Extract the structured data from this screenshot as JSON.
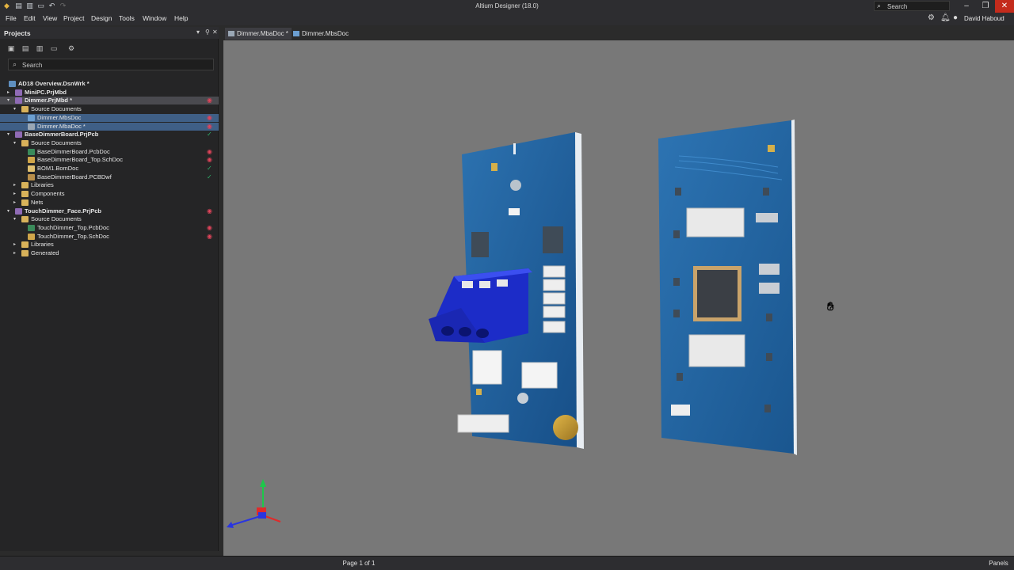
{
  "window": {
    "title": "Altium Designer (18.0)",
    "search_placeholder": "Search",
    "user": "David Haboud"
  },
  "menu": [
    "File",
    "Edit",
    "View",
    "Project",
    "Design",
    "Tools",
    "Window",
    "Help"
  ],
  "projects_panel": {
    "title": "Projects",
    "search_placeholder": "Search",
    "tree": [
      {
        "label": "AD18 Overview.DsnWrk *",
        "icon": "workspace-icon",
        "level": 0,
        "bold": true,
        "status": ""
      },
      {
        "label": "MiniPC.PrjMbd",
        "icon": "project-icon",
        "level": 1,
        "bold": true,
        "status": "",
        "arrow": "▸"
      },
      {
        "label": "Dimmer.PrjMbd *",
        "icon": "project-icon",
        "level": 1,
        "bold": true,
        "status": "modified",
        "arrow": "▾",
        "selected": true
      },
      {
        "label": "Source Documents",
        "icon": "folder-icon",
        "level": 2,
        "status": "",
        "arrow": "▾"
      },
      {
        "label": "Dimmer.MbsDoc",
        "icon": "mbs-doc-icon",
        "level": 3,
        "status": "modified",
        "current": true
      },
      {
        "label": "Dimmer.MbaDoc *",
        "icon": "mba-doc-icon",
        "level": 3,
        "status": "modified",
        "current": true
      },
      {
        "label": "BaseDimmerBoard.PrjPcb",
        "icon": "project-icon",
        "level": 1,
        "bold": true,
        "status": "ok",
        "arrow": "▾"
      },
      {
        "label": "Source Documents",
        "icon": "folder-icon",
        "level": 2,
        "status": "",
        "arrow": "▾"
      },
      {
        "label": "BaseDimmerBoard.PcbDoc",
        "icon": "pcb-doc-icon",
        "level": 3,
        "status": "modified"
      },
      {
        "label": "BaseDimmerBoard_Top.SchDoc",
        "icon": "sch-doc-icon",
        "level": 3,
        "status": "modified"
      },
      {
        "label": "BOM1.BomDoc",
        "icon": "bom-doc-icon",
        "level": 3,
        "status": "ok"
      },
      {
        "label": "BaseDimmerBoard.PCBDwf",
        "icon": "dwf-doc-icon",
        "level": 3,
        "status": "ok"
      },
      {
        "label": "Libraries",
        "icon": "folder-icon",
        "level": 2,
        "status": "",
        "arrow": "▸"
      },
      {
        "label": "Components",
        "icon": "folder-icon",
        "level": 2,
        "status": "",
        "arrow": "▸"
      },
      {
        "label": "Nets",
        "icon": "folder-icon",
        "level": 2,
        "status": "",
        "arrow": "▸"
      },
      {
        "label": "TouchDimmer_Face.PrjPcb",
        "icon": "project-icon",
        "level": 1,
        "bold": true,
        "status": "modified",
        "arrow": "▾"
      },
      {
        "label": "Source Documents",
        "icon": "folder-icon",
        "level": 2,
        "status": "",
        "arrow": "▾"
      },
      {
        "label": "TouchDimmer_Top.PcbDoc",
        "icon": "pcb-doc-icon",
        "level": 3,
        "status": "modified"
      },
      {
        "label": "TouchDimmer_Top.SchDoc",
        "icon": "sch-doc-icon",
        "level": 3,
        "status": "modified"
      },
      {
        "label": "Libraries",
        "icon": "folder-icon",
        "level": 2,
        "status": "",
        "arrow": "▸"
      },
      {
        "label": "Generated",
        "icon": "folder-icon",
        "level": 2,
        "status": "",
        "arrow": "▸"
      }
    ]
  },
  "tabs": [
    {
      "label": "Dimmer.MbaDoc *",
      "active": true
    },
    {
      "label": "Dimmer.MbsDoc",
      "active": false
    }
  ],
  "status": {
    "page": "Page 1 of 1",
    "panels_button": "Panels"
  },
  "colors": {
    "accent": "#3f5f86",
    "modified": "#e0445a",
    "ok": "#2fb36b",
    "pcb_blue": "#1f5f9a",
    "terminal_blue": "#1f2fd0",
    "viewport_bg": "#787878"
  }
}
